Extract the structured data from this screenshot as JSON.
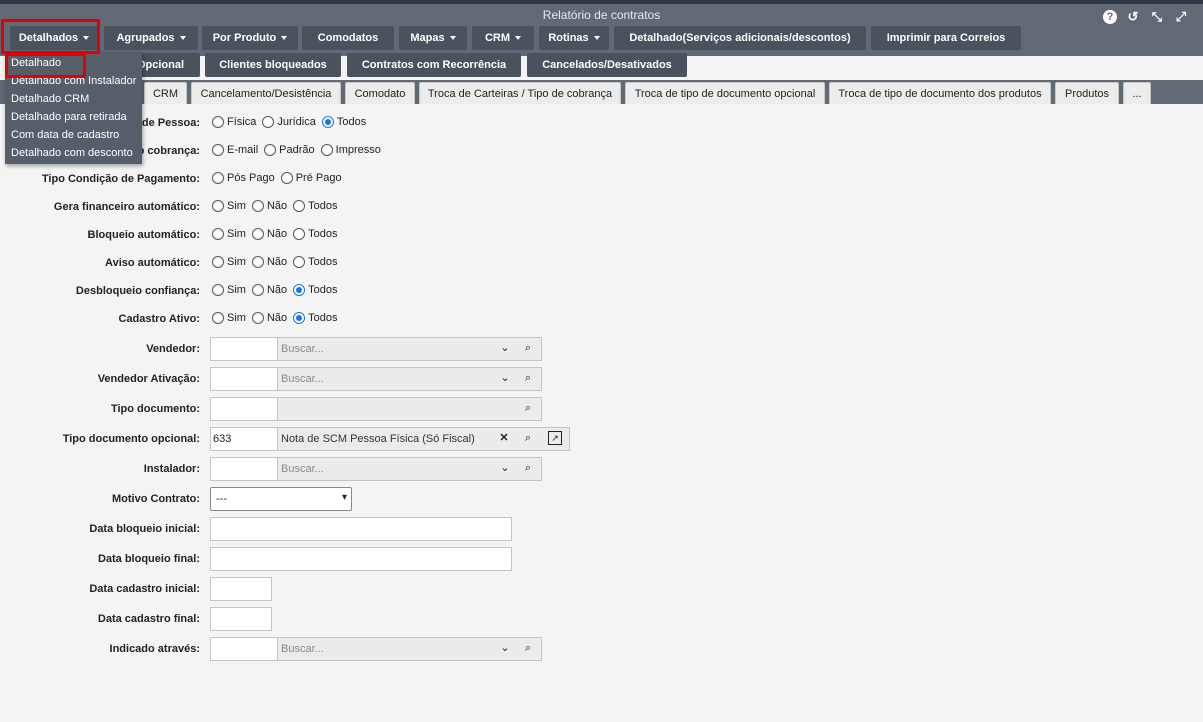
{
  "window": {
    "title": "Relatório de contratos",
    "icons": [
      "help-icon",
      "history-icon",
      "minimize-icon",
      "maximize-icon"
    ]
  },
  "toolbar": {
    "row1": [
      {
        "label": "Detalhados",
        "caret": true
      },
      {
        "label": "Agrupados",
        "caret": true
      },
      {
        "label": "Por Produto",
        "caret": true
      },
      {
        "label": "Comodatos",
        "caret": false
      },
      {
        "label": "Mapas",
        "caret": true
      },
      {
        "label": "CRM",
        "caret": true
      },
      {
        "label": "Rotinas",
        "caret": true
      },
      {
        "label": "Detalhado(Serviços adicionais/descontos)",
        "caret": false
      },
      {
        "label": "Imprimir para Correios",
        "caret": false
      }
    ],
    "row2": [
      {
        "label": "Opcional"
      },
      {
        "label": "Clientes bloqueados"
      },
      {
        "label": "Contratos com Recorrência"
      },
      {
        "label": "Cancelados/Desativados"
      }
    ]
  },
  "dropdown": {
    "items": [
      "Detalhado",
      "Detalhado com Instalador",
      "Detalhado CRM",
      "Detalhado para retirada",
      "Com data de cadastro",
      "Detalhado com desconto"
    ]
  },
  "tabs": [
    "CRM",
    "Cancelamento/Desistência",
    "Comodato",
    "Troca de Carteiras / Tipo de cobrança",
    "Troca de tipo de documento opcional",
    "Troca de tipo de documento dos produtos",
    "Produtos",
    "..."
  ],
  "form": {
    "tipo_pessoa": {
      "label": "de Pessoa:",
      "options": [
        "Física",
        "Jurídica",
        "Todos"
      ],
      "selected": 2
    },
    "tipo_cobranca": {
      "label": "o cobrança:",
      "options": [
        "E-mail",
        "Padrão",
        "Impresso"
      ],
      "selected": -1
    },
    "condicao_pagamento": {
      "label": "Tipo Condição de Pagamento:",
      "options": [
        "Pós Pago",
        "Pré Pago"
      ],
      "selected": -1
    },
    "gera_financeiro": {
      "label": "Gera financeiro automático:",
      "options": [
        "Sim",
        "Não",
        "Todos"
      ],
      "selected": -1
    },
    "bloqueio_automatico": {
      "label": "Bloqueio automático:",
      "options": [
        "Sim",
        "Não",
        "Todos"
      ],
      "selected": -1
    },
    "aviso_automatico": {
      "label": "Aviso automático:",
      "options": [
        "Sim",
        "Não",
        "Todos"
      ],
      "selected": -1
    },
    "desbloqueio_confianca": {
      "label": "Desbloqueio confiança:",
      "options": [
        "Sim",
        "Não",
        "Todos"
      ],
      "selected": 2
    },
    "cadastro_ativo": {
      "label": "Cadastro Ativo:",
      "options": [
        "Sim",
        "Não",
        "Todos"
      ],
      "selected": 2
    },
    "vendedor": {
      "label": "Vendedor:",
      "code": "",
      "placeholder": "Buscar..."
    },
    "vendedor_ativacao": {
      "label": "Vendedor Ativação:",
      "code": "",
      "placeholder": "Buscar..."
    },
    "tipo_documento": {
      "label": "Tipo documento:",
      "code": "",
      "placeholder": ""
    },
    "tipo_documento_opcional": {
      "label": "Tipo documento opcional:",
      "code": "633",
      "value": "Nota de SCM Pessoa Física  (Só Fiscal)"
    },
    "instalador": {
      "label": "Instalador:",
      "code": "",
      "placeholder": "Buscar..."
    },
    "motivo_contrato": {
      "label": "Motivo Contrato:",
      "value": "---"
    },
    "data_bloqueio_inicial": {
      "label": "Data bloqueio inicial:"
    },
    "data_bloqueio_final": {
      "label": "Data bloqueio final:"
    },
    "data_cadastro_inicial": {
      "label": "Data cadastro inicial:"
    },
    "data_cadastro_final": {
      "label": "Data cadastro final:"
    },
    "indicado_atraves": {
      "label": "Indicado através:",
      "code": "",
      "placeholder": "Buscar..."
    }
  }
}
